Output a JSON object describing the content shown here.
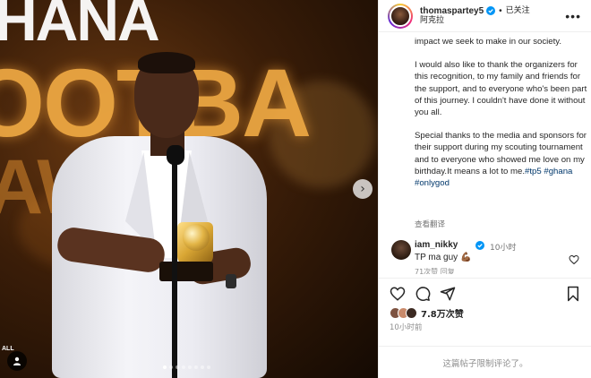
{
  "photo": {
    "background_text": [
      "HANA",
      "OOTBA",
      "AW  R"
    ],
    "corner_text": "ALL"
  },
  "post_header": {
    "username": "thomaspartey5",
    "verified_icon": "verified-badge-icon",
    "follow_state": "已关注",
    "location": "阿克拉",
    "more_icon": "more-options-icon"
  },
  "caption": {
    "p1": "impact we seek to make in our society.",
    "p2": "I would also like to thank the organizers for this recognition, to my family and friends for the support, and to everyone who's been part of this journey. I couldn't have done it without you all.",
    "p3_text": "Special thanks to the media and sponsors for their support during my scouting tournament and to everyone who showed me love on my birthday.It means a lot to me.",
    "hashtag1": "#tp5",
    "hashtag2": "#ghana",
    "hashtag3": "#onlygod",
    "translate_label": "查看翻译"
  },
  "comment": {
    "username": "iam_nikky",
    "time": "10小时",
    "text": "TP ma guy 💪🏾",
    "meta": "71次赞   回复"
  },
  "actions": {
    "like_icon": "heart-icon",
    "comment_icon": "comment-icon",
    "share_icon": "share-icon",
    "save_icon": "bookmark-icon"
  },
  "likes": {
    "count": "7.8万次赞"
  },
  "post_time": "10小时前",
  "comment_limit": "这篇帖子限制评论了。",
  "colors": {
    "link": "#00376b",
    "verified": "#0095f6",
    "secondary_text": "#737373"
  }
}
